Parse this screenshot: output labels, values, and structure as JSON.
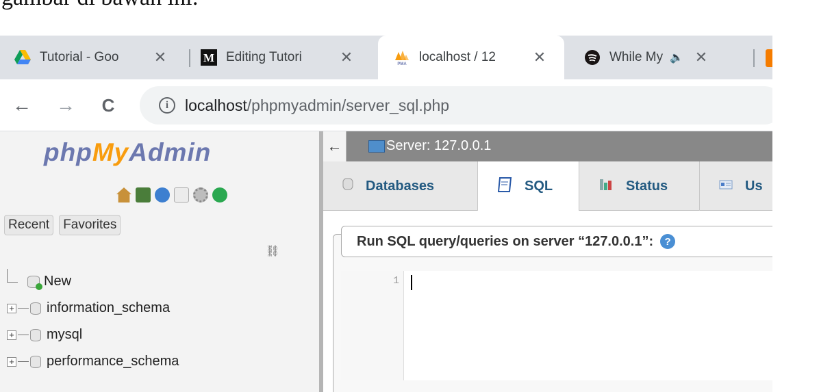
{
  "caption": "gambar di bawah ini:",
  "browser": {
    "tabs": [
      {
        "title": "Tutorial - Goo",
        "favicon": "google-drive-icon",
        "active": false
      },
      {
        "title": "Editing Tutori",
        "favicon": "medium-icon",
        "active": false
      },
      {
        "title": "localhost / 12",
        "favicon": "phpmyadmin-icon",
        "active": true
      },
      {
        "title": "While My",
        "favicon": "spotify-icon",
        "active": false,
        "audio": true
      }
    ],
    "close_glyph": "✕",
    "audio_glyph": "🔈",
    "nav": {
      "back": "←",
      "forward": "→",
      "reload": "C"
    },
    "address": {
      "host": "localhost",
      "path": "/phpmyadmin/server_sql.php"
    }
  },
  "pma": {
    "logo": {
      "php": "php",
      "my": "My",
      "admin": "Admin"
    },
    "quick_icons": [
      "home-icon",
      "exit-icon",
      "help-icon",
      "docs-icon",
      "settings-icon",
      "reload-icon"
    ],
    "recent_label": "Recent",
    "favorites_label": "Favorites",
    "link_glyph": "⛓",
    "tree": [
      {
        "label": "New",
        "type": "new"
      },
      {
        "label": "information_schema",
        "type": "db"
      },
      {
        "label": "mysql",
        "type": "db"
      },
      {
        "label": "performance_schema",
        "type": "db"
      }
    ],
    "server_label": "Server: 127.0.0.1",
    "back_glyph": "←",
    "tabs": [
      {
        "label": "Databases",
        "icon": "database-icon",
        "active": false
      },
      {
        "label": "SQL",
        "icon": "sql-icon",
        "active": true
      },
      {
        "label": "Status",
        "icon": "status-icon",
        "active": false
      },
      {
        "label": "Us",
        "icon": "users-icon",
        "active": false
      }
    ],
    "query_heading": "Run SQL query/queries on server “127.0.0.1”:",
    "help_glyph": "?",
    "editor": {
      "line_number": "1",
      "content": ""
    }
  }
}
